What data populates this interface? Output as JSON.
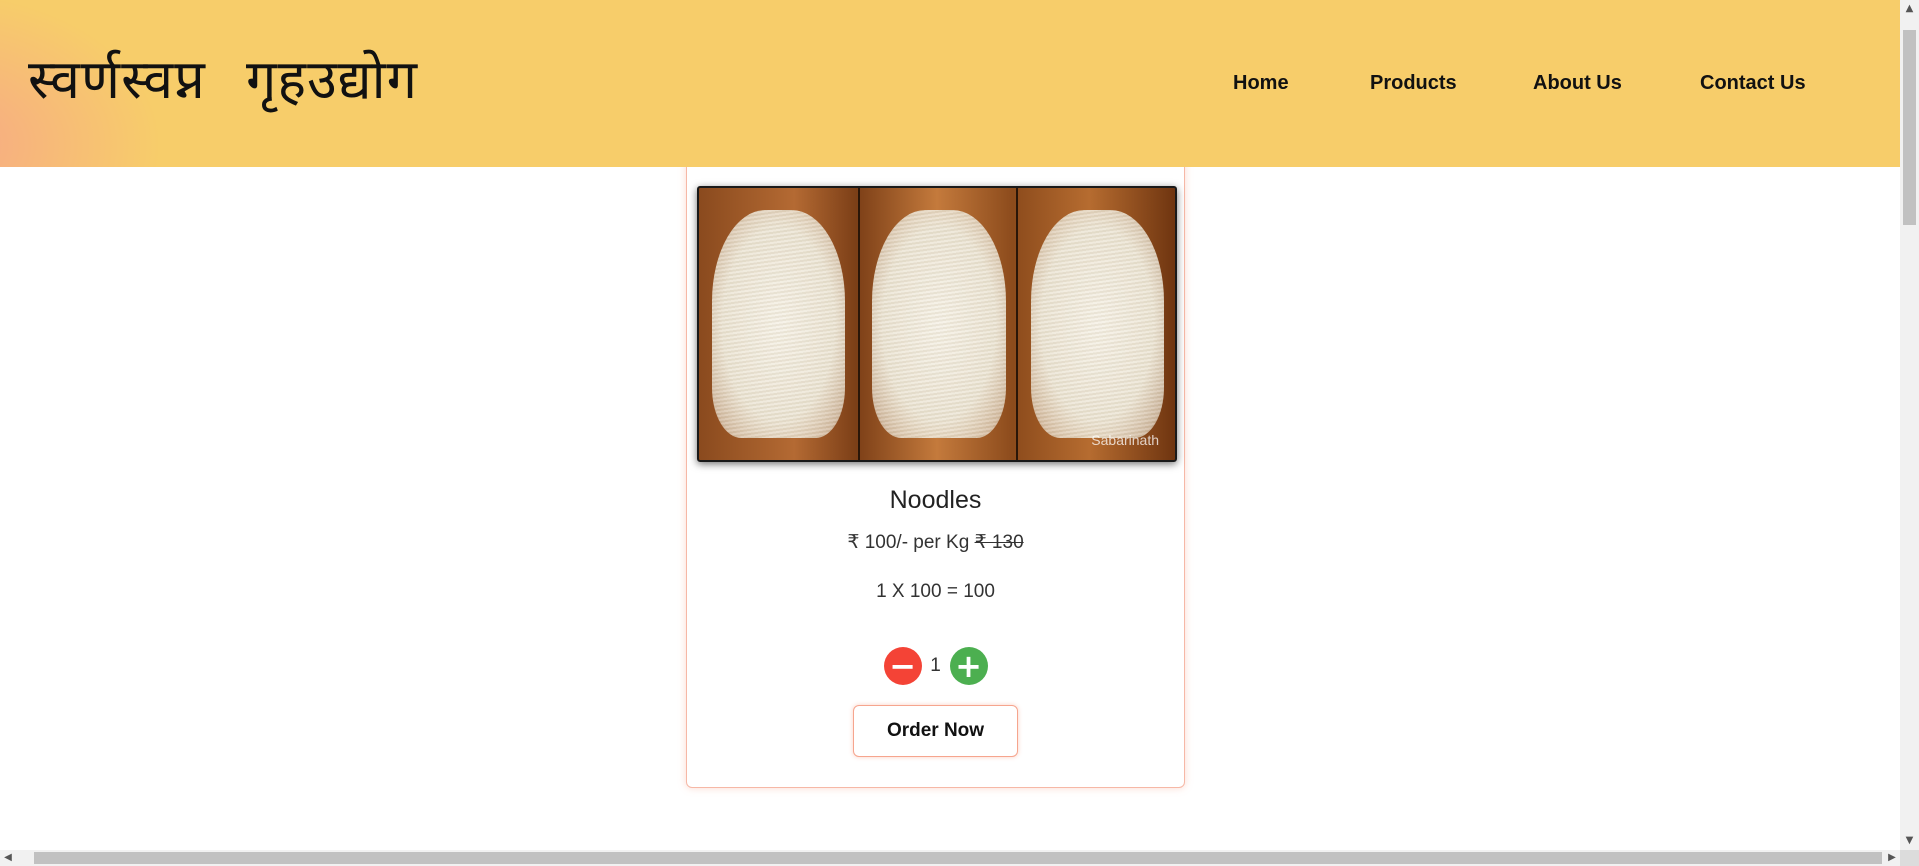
{
  "header": {
    "brand": "स्वर्णस्वप्न गृहउद्योग",
    "background_color": "#f7cd6a",
    "nav": [
      {
        "label": "Home"
      },
      {
        "label": "Products"
      },
      {
        "label": "About Us"
      },
      {
        "label": "Contact Us"
      }
    ]
  },
  "product": {
    "name": "Noodles",
    "price_text": "₹ 100/- per Kg",
    "old_price": "₹ 130",
    "total_text": "1 X 100 = 100",
    "quantity": "1",
    "decrement_symbol": "−",
    "increment_symbol": "+",
    "order_label": "Order Now",
    "image_watermark": "Sabarinath",
    "image_icon": "noodles-photo"
  },
  "colors": {
    "minus": "#f44336",
    "plus": "#4caf50",
    "card_border": "#f6b8a6"
  }
}
